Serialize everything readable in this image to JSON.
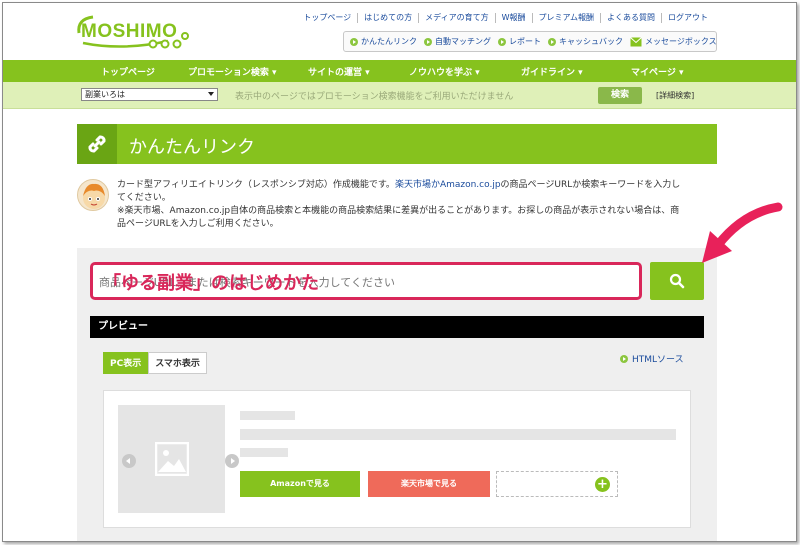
{
  "logo": {
    "text": "MOSHIMO"
  },
  "top_links": [
    "トップページ",
    "はじめての方",
    "メディアの育て方",
    "W報酬",
    "プレミアム報酬",
    "よくある質問",
    "ログアウト"
  ],
  "quick_links": [
    {
      "label": "かんたんリンク",
      "icon": "play-icon"
    },
    {
      "label": "自動マッチング",
      "icon": "play-icon"
    },
    {
      "label": "レポート",
      "icon": "play-icon"
    },
    {
      "label": "キャッシュバック",
      "icon": "play-icon"
    },
    {
      "label": "メッセージボックス",
      "icon": "mail-icon"
    }
  ],
  "main_nav": [
    "トップページ",
    "プロモーション検索 ▾",
    "サイトの運営 ▾",
    "ノウハウを学ぶ ▾",
    "ガイドライン ▾",
    "マイページ ▾"
  ],
  "search_bar": {
    "category_value": "副業いろは",
    "notice": "表示中のページではプロモーション検索機能をご利用いただけません",
    "search_label": "検索",
    "advanced_label": "[詳細検索]"
  },
  "page": {
    "title": "かんたんリンク",
    "intro_line1_a": "カード型アフィリエイトリンク（レスポンシブ対応）作成機能です。",
    "intro_line1_link": "楽天市場かAmazon.co.jp",
    "intro_line1_b": "の商品ページURLか検索キーワードを入力し",
    "intro_line2": "てください。",
    "intro_line3": "※楽天市場、Amazon.co.jp自体の商品検索と本機能の商品検索結果に差異が出ることがあります。お探しの商品が表示されない場合は、商",
    "intro_line4": "品ページURLを入力しご利用ください。"
  },
  "tool": {
    "input_placeholder": "商品ページURL、または検索キーワードを入力してください",
    "overlay_label": "「ゆる副業」のはじめかた",
    "preview_label": "プレビュー",
    "tab_pc": "PC表示",
    "tab_sp": "スマホ表示",
    "html_source": "HTMLソース",
    "amazon_button": "Amazonで見る",
    "rakuten_button": "楽天市場で見る"
  },
  "colors": {
    "brand_green": "#86c21e",
    "highlight_red": "#d9275a",
    "rakuten_red": "#ef6a5a"
  }
}
